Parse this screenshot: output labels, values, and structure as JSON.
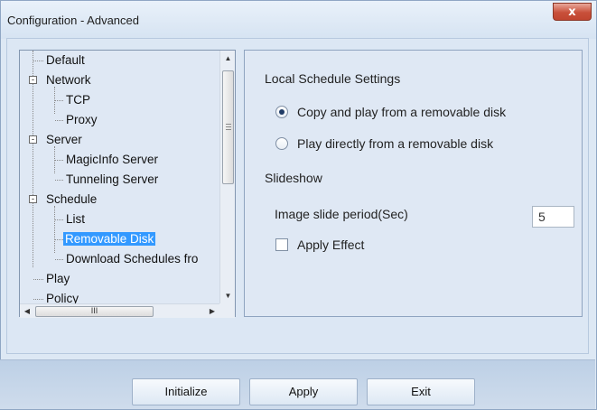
{
  "window": {
    "title": "Configuration - Advanced",
    "close_label": "x"
  },
  "tree": {
    "items": [
      {
        "label": "Default"
      },
      {
        "label": "Network",
        "expander": "-"
      },
      {
        "label": "TCP"
      },
      {
        "label": "Proxy"
      },
      {
        "label": "Server",
        "expander": "-"
      },
      {
        "label": "MagicInfo Server"
      },
      {
        "label": "Tunneling Server"
      },
      {
        "label": "Schedule",
        "expander": "-"
      },
      {
        "label": "List"
      },
      {
        "label": "Removable Disk",
        "selected": true
      },
      {
        "label": "Download Schedules fro"
      },
      {
        "label": "Play"
      },
      {
        "label": "Policy"
      }
    ],
    "scroll_up": "▲",
    "scroll_down": "▼",
    "scroll_left": "◀",
    "scroll_right": "▶",
    "hthumb_grip": "III"
  },
  "settings": {
    "section_title": "Local Schedule Settings",
    "radio_copy_label": "Copy and play from a removable disk",
    "radio_copy_checked": true,
    "radio_direct_label": "Play directly from a removable disk",
    "radio_direct_checked": false,
    "slideshow_title": "Slideshow",
    "slide_period_label": "Image slide period(Sec)",
    "slide_period_value": "5",
    "apply_effect_label": "Apply Effect",
    "apply_effect_checked": false
  },
  "buttons": {
    "initialize": "Initialize",
    "apply": "Apply",
    "exit": "Exit"
  },
  "colors": {
    "selection": "#3399ff",
    "close_button": "#c9503a"
  }
}
